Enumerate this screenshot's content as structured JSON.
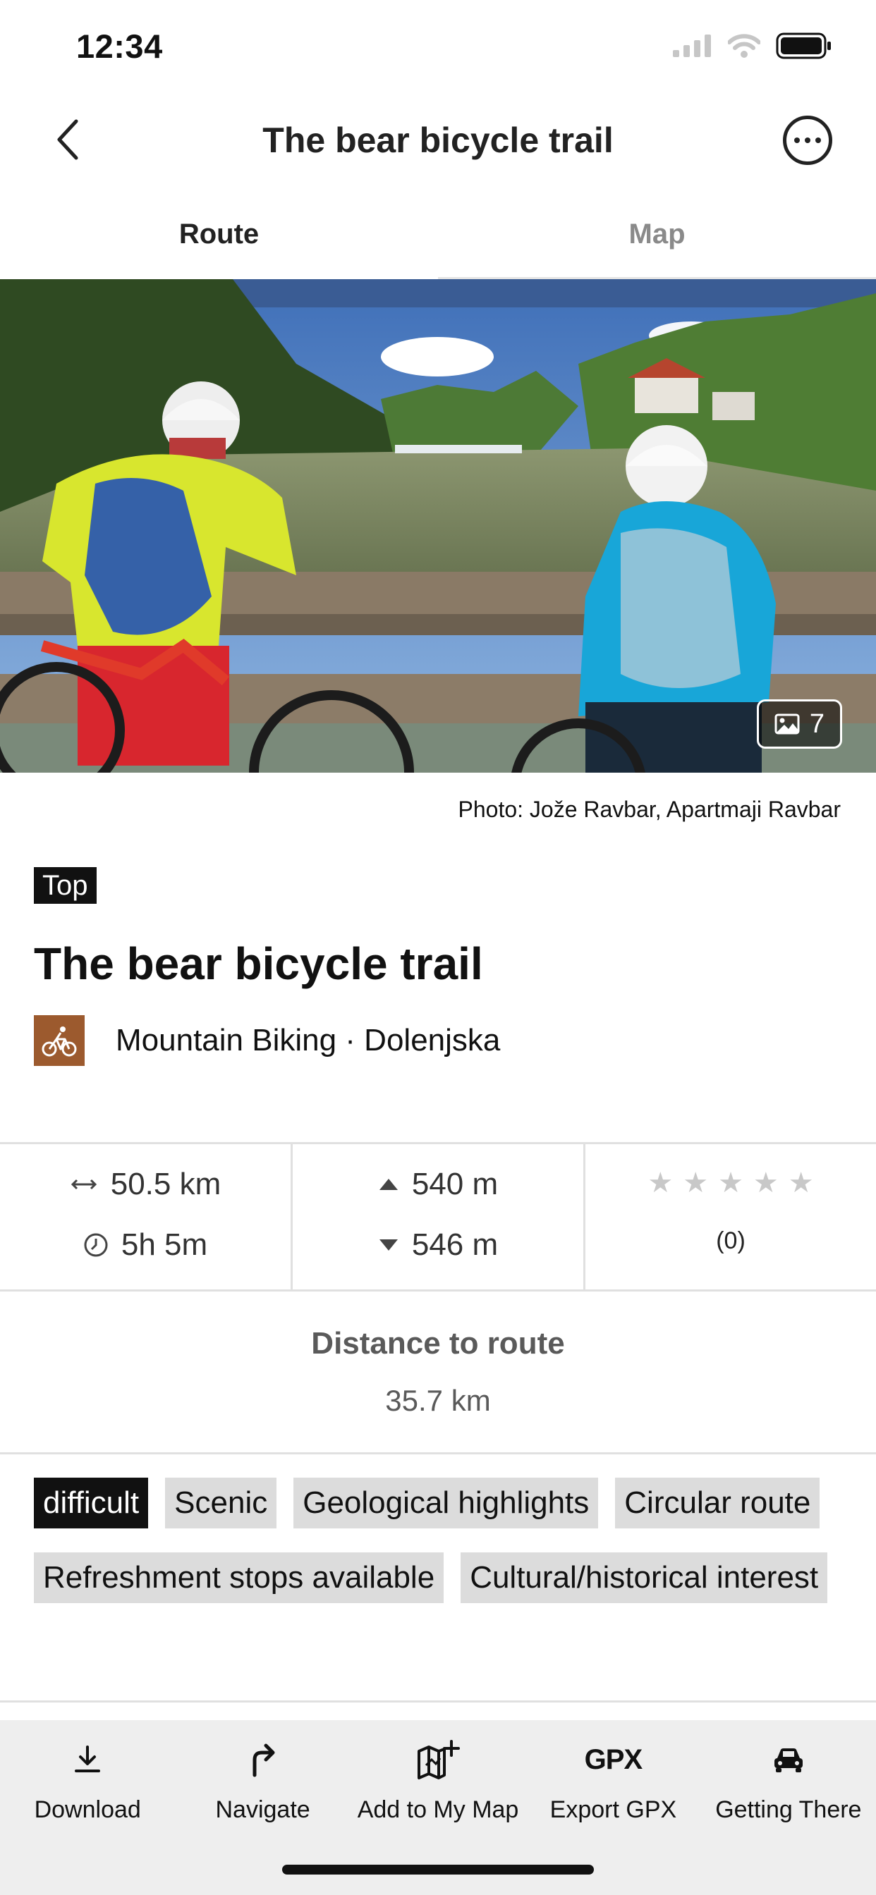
{
  "status_bar": {
    "time": "12:34"
  },
  "header": {
    "title": "The bear bicycle trail"
  },
  "tabs": [
    {
      "label": "Route",
      "active": true
    },
    {
      "label": "Map",
      "active": false
    }
  ],
  "hero": {
    "photo_count": "7"
  },
  "photo_credit": "Photo: Jože Ravbar, Apartmaji Ravbar",
  "badge": "Top",
  "route": {
    "title": "The bear bicycle trail",
    "category": "Mountain Biking · Dolenjska",
    "category_icon": "mountain-bike-icon",
    "category_color": "#9c5a2e"
  },
  "stats": {
    "distance": "50.5 km",
    "duration": "5h 5m",
    "ascent": "540 m",
    "descent": "546 m",
    "rating_stars": 0,
    "rating_count": "(0)"
  },
  "distance_to_route": {
    "label": "Distance to route",
    "value": "35.7 km"
  },
  "tags": [
    {
      "label": "difficult",
      "highlight": true
    },
    {
      "label": "Scenic",
      "highlight": false
    },
    {
      "label": "Geological highlights",
      "highlight": false
    },
    {
      "label": "Circular route",
      "highlight": false
    },
    {
      "label": "Refreshment stops available",
      "highlight": false
    },
    {
      "label": "Cultural/historical interest",
      "highlight": false
    }
  ],
  "toolbar": {
    "download": "Download",
    "navigate": "Navigate",
    "add_to_map": "Add to My Map",
    "export_gpx": "Export GPX",
    "gpx_icon_text": "GPX",
    "getting_there": "Getting There"
  }
}
